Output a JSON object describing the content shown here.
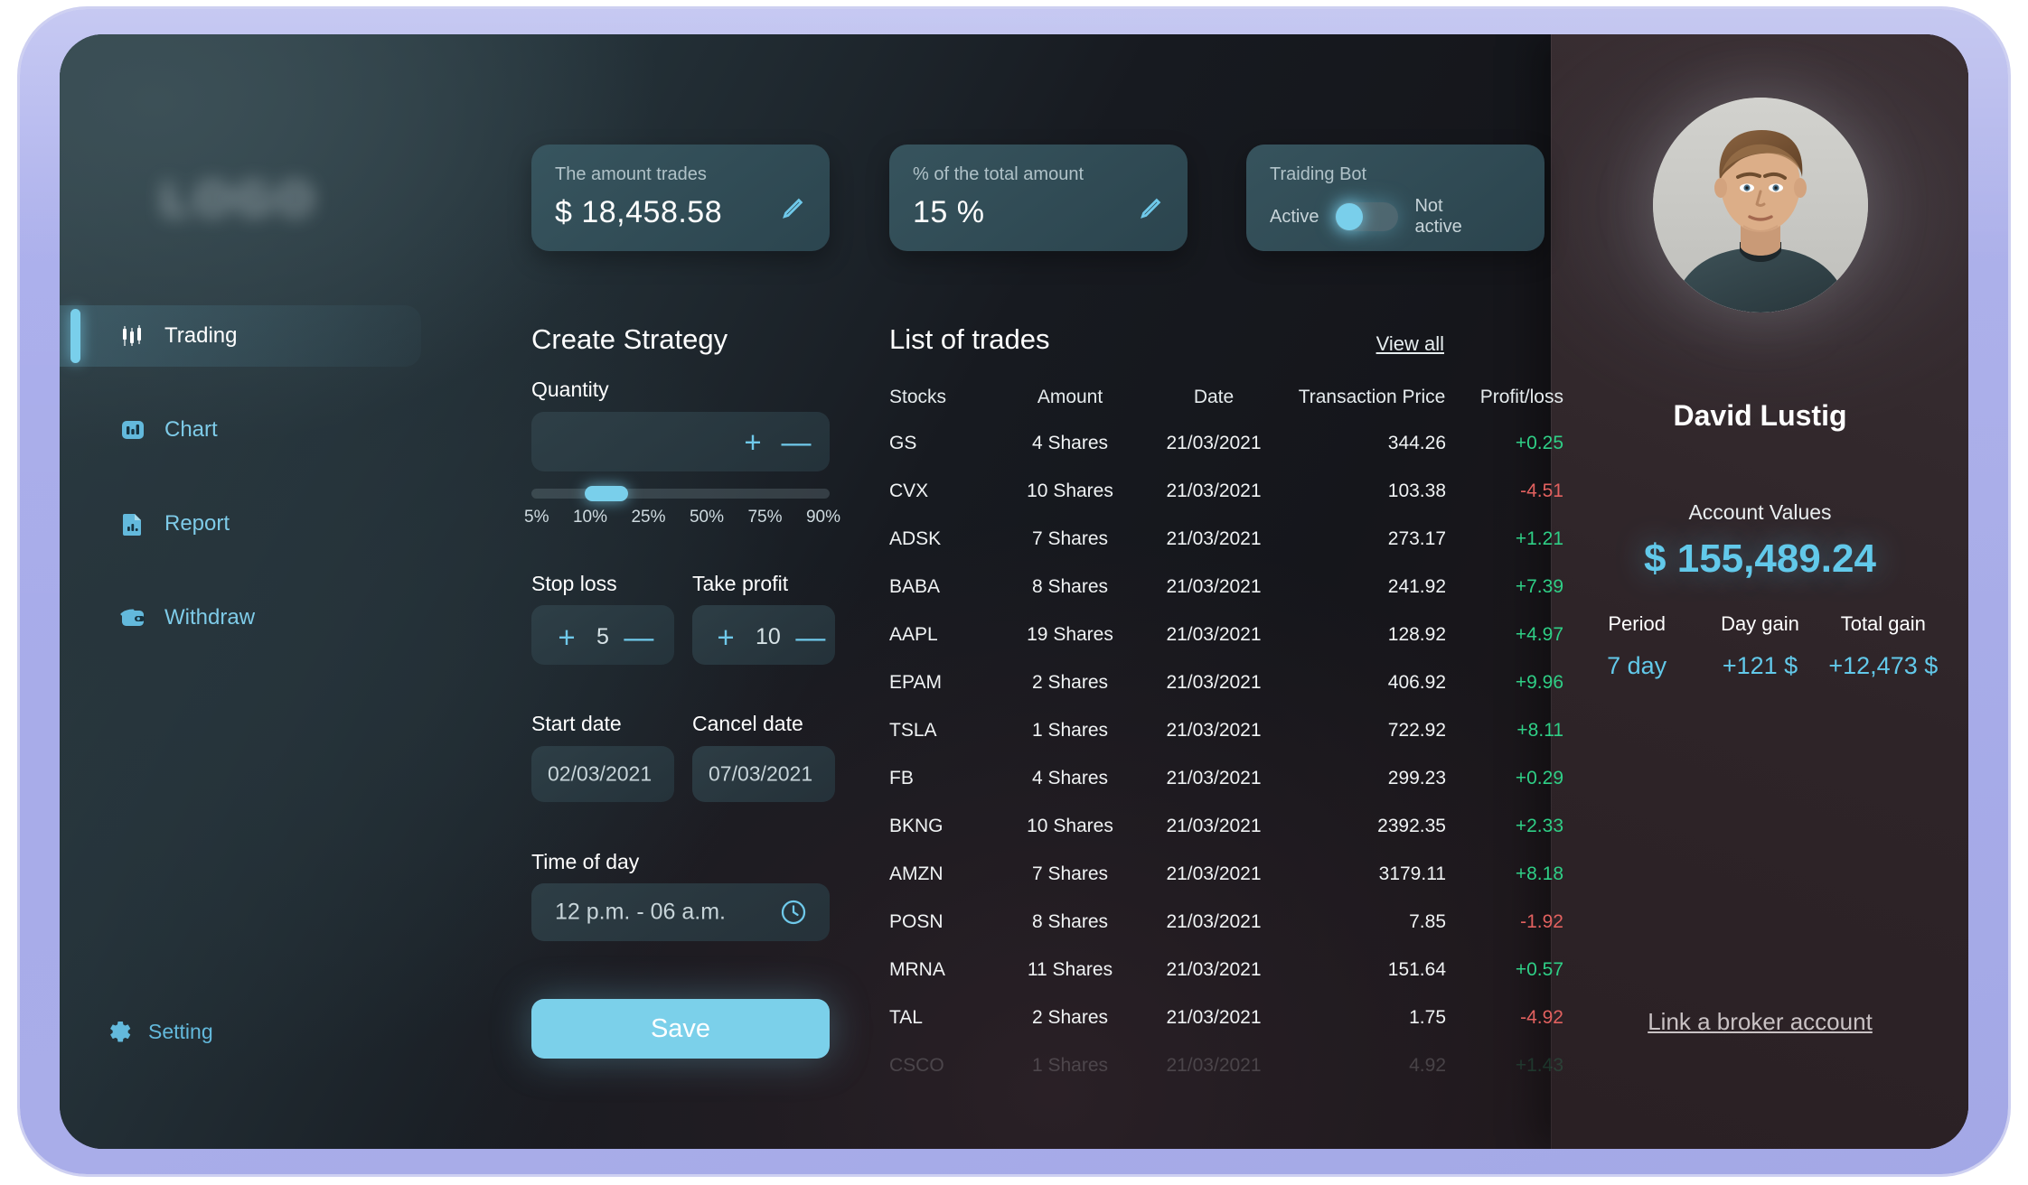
{
  "brand": {
    "logo_text": "LOGO"
  },
  "stat_cards": {
    "amount": {
      "label": "The amount trades",
      "value": "$ 18,458.58",
      "edit_icon": "pencil-icon"
    },
    "percent": {
      "label": "% of the total amount",
      "value": "15 %",
      "edit_icon": "pencil-icon"
    },
    "bot": {
      "label": "Traiding Bot",
      "active_label": "Active",
      "inactive_label": "Not active",
      "state": "Active"
    }
  },
  "sidebar": {
    "items": [
      {
        "label": "Trading",
        "icon": "candlestick-chart-icon",
        "active": true
      },
      {
        "label": "Chart",
        "icon": "bar-chart-icon",
        "active": false
      },
      {
        "label": "Report",
        "icon": "document-chart-icon",
        "active": false
      },
      {
        "label": "Withdraw",
        "icon": "wallet-icon",
        "active": false
      }
    ],
    "setting": {
      "label": "Setting",
      "icon": "gear-icon"
    }
  },
  "strategy": {
    "title": "Create Strategy",
    "quantity": {
      "label": "Quantity",
      "value": "",
      "placeholder": "",
      "increment_label": "+",
      "decrement_label": "—",
      "slider_ticks": [
        "5%",
        "10%",
        "25%",
        "50%",
        "75%",
        "90%"
      ],
      "slider_position_percent": 21
    },
    "stop_loss": {
      "label": "Stop loss",
      "value": "5",
      "increment_label": "+",
      "decrement_label": "—"
    },
    "take_profit": {
      "label": "Take profit",
      "value": "10",
      "increment_label": "+",
      "decrement_label": "—"
    },
    "start_date": {
      "label": "Start date",
      "value": "02/03/2021"
    },
    "cancel_date": {
      "label": "Cancel date",
      "value": "07/03/2021"
    },
    "time_of_day": {
      "label": "Time of day",
      "value": "12 p.m. - 06 a.m.",
      "icon": "clock-icon"
    },
    "save_label": "Save"
  },
  "trades": {
    "title": "List of trades",
    "view_all_label": "View all",
    "columns": [
      "Stocks",
      "Amount",
      "Date",
      "Transaction Price",
      "Profit/loss"
    ],
    "rows": [
      {
        "stock": "GS",
        "amount": "4 Shares",
        "date": "21/03/2021",
        "price": "344.26",
        "pl": "+0.25",
        "pl_sign": "pos",
        "faded": false
      },
      {
        "stock": "CVX",
        "amount": "10 Shares",
        "date": "21/03/2021",
        "price": "103.38",
        "pl": "-4.51",
        "pl_sign": "neg",
        "faded": false
      },
      {
        "stock": "ADSK",
        "amount": "7 Shares",
        "date": "21/03/2021",
        "price": "273.17",
        "pl": "+1.21",
        "pl_sign": "pos",
        "faded": false
      },
      {
        "stock": "BABA",
        "amount": "8 Shares",
        "date": "21/03/2021",
        "price": "241.92",
        "pl": "+7.39",
        "pl_sign": "pos",
        "faded": false
      },
      {
        "stock": "AAPL",
        "amount": "19 Shares",
        "date": "21/03/2021",
        "price": "128.92",
        "pl": "+4.97",
        "pl_sign": "pos",
        "faded": false
      },
      {
        "stock": "EPAM",
        "amount": "2 Shares",
        "date": "21/03/2021",
        "price": "406.92",
        "pl": "+9.96",
        "pl_sign": "pos",
        "faded": false
      },
      {
        "stock": "TSLA",
        "amount": "1 Shares",
        "date": "21/03/2021",
        "price": "722.92",
        "pl": "+8.11",
        "pl_sign": "pos",
        "faded": false
      },
      {
        "stock": "FB",
        "amount": "4 Shares",
        "date": "21/03/2021",
        "price": "299.23",
        "pl": "+0.29",
        "pl_sign": "pos",
        "faded": false
      },
      {
        "stock": "BKNG",
        "amount": "10 Shares",
        "date": "21/03/2021",
        "price": "2392.35",
        "pl": "+2.33",
        "pl_sign": "pos",
        "faded": false
      },
      {
        "stock": "AMZN",
        "amount": "7 Shares",
        "date": "21/03/2021",
        "price": "3179.11",
        "pl": "+8.18",
        "pl_sign": "pos",
        "faded": false
      },
      {
        "stock": "POSN",
        "amount": "8 Shares",
        "date": "21/03/2021",
        "price": "7.85",
        "pl": "-1.92",
        "pl_sign": "neg",
        "faded": false
      },
      {
        "stock": "MRNA",
        "amount": "11 Shares",
        "date": "21/03/2021",
        "price": "151.64",
        "pl": "+0.57",
        "pl_sign": "pos",
        "faded": false
      },
      {
        "stock": "TAL",
        "amount": "2 Shares",
        "date": "21/03/2021",
        "price": "1.75",
        "pl": "-4.92",
        "pl_sign": "neg",
        "faded": false
      },
      {
        "stock": "CSCO",
        "amount": "1 Shares",
        "date": "21/03/2021",
        "price": "4.92",
        "pl": "+1.43",
        "pl_sign": "pos",
        "faded": true
      }
    ]
  },
  "profile": {
    "name": "David Lustig",
    "avatar_icon": "user-photo-avatar",
    "account_values_label": "Account Values",
    "account_value": "$ 155,489.24",
    "stats": [
      {
        "label": "Period",
        "value": "7 day"
      },
      {
        "label": "Day gain",
        "value": "+121 $"
      },
      {
        "label": "Total gain",
        "value": "+12,473 $"
      }
    ],
    "broker_link_label": "Link a broker account"
  },
  "colors": {
    "accent": "#79cfeb",
    "profit": "#2fcf86",
    "loss": "#e2615f",
    "frame": "#a9adec"
  }
}
